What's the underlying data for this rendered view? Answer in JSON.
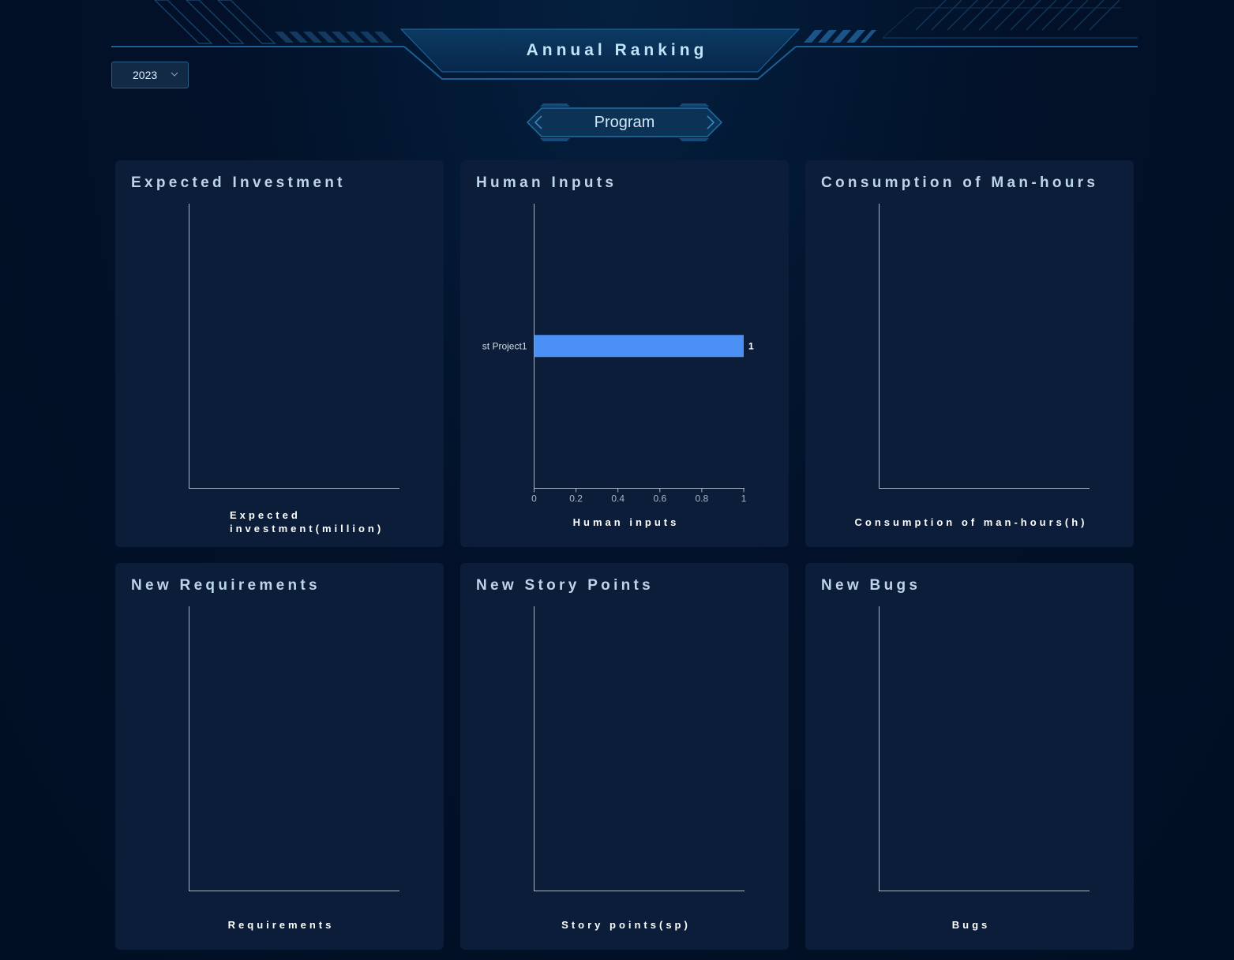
{
  "header": {
    "title": "Annual Ranking"
  },
  "year_select": {
    "value": "2023"
  },
  "tab": {
    "label": "Program"
  },
  "panels": [
    {
      "title": "Expected Investment",
      "xlabel_line1": "Expected",
      "xlabel_line2": "investment(million)"
    },
    {
      "title": "Human Inputs",
      "xlabel": "Human inputs"
    },
    {
      "title": "Consumption of Man-hours",
      "xlabel": "Consumption of man-hours(h)"
    },
    {
      "title": "New Requirements",
      "xlabel": "Requirements"
    },
    {
      "title": "New Story Points",
      "xlabel": "Story points(sp)"
    },
    {
      "title": "New Bugs",
      "xlabel": "Bugs"
    }
  ],
  "colors": {
    "bar": "#4a90f5",
    "axis": "#a9b6c8",
    "title": "#bcd5ea"
  },
  "chart_data": [
    {
      "type": "bar",
      "orientation": "horizontal",
      "title": "Expected Investment",
      "xlabel": "Expected investment(million)",
      "categories": [],
      "values": []
    },
    {
      "type": "bar",
      "orientation": "horizontal",
      "title": "Human Inputs",
      "xlabel": "Human inputs",
      "categories": [
        "st Project1"
      ],
      "values": [
        1
      ],
      "data_labels": [
        "1"
      ],
      "xlim": [
        0,
        1
      ],
      "xticks": [
        "0",
        "0.2",
        "0.4",
        "0.6",
        "0.8",
        "1"
      ],
      "grid": false
    },
    {
      "type": "bar",
      "orientation": "horizontal",
      "title": "Consumption of Man-hours",
      "xlabel": "Consumption of man-hours(h)",
      "categories": [],
      "values": []
    },
    {
      "type": "bar",
      "orientation": "horizontal",
      "title": "New Requirements",
      "xlabel": "Requirements",
      "categories": [],
      "values": []
    },
    {
      "type": "bar",
      "orientation": "horizontal",
      "title": "New Story Points",
      "xlabel": "Story points(sp)",
      "categories": [],
      "values": []
    },
    {
      "type": "bar",
      "orientation": "horizontal",
      "title": "New Bugs",
      "xlabel": "Bugs",
      "categories": [],
      "values": []
    }
  ]
}
